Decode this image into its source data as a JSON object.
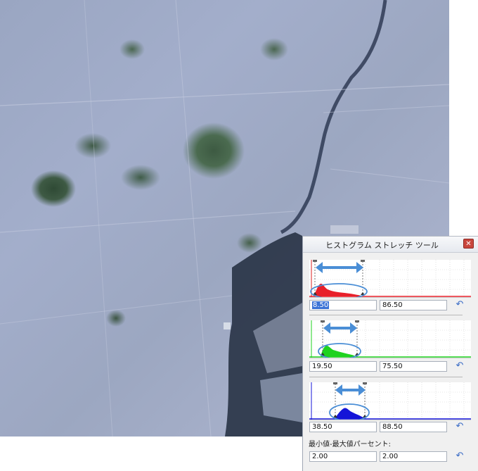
{
  "dialog": {
    "title": "ヒストグラム ストレッチ ツール",
    "close_icon": "close-icon"
  },
  "channels": [
    {
      "name": "red",
      "color": "#e8202a",
      "min_value": "8.50",
      "max_value": "86.50",
      "min_selected": true
    },
    {
      "name": "green",
      "color": "#1fd21f",
      "min_value": "19.50",
      "max_value": "75.50",
      "min_selected": false
    },
    {
      "name": "blue",
      "color": "#1414d8",
      "min_value": "38.50",
      "max_value": "88.50",
      "min_selected": false
    }
  ],
  "percent": {
    "label": "最小値-最大値パーセント:",
    "min_value": "2.00",
    "max_value": "2.00"
  },
  "icons": {
    "reset": "undo-icon",
    "stretch": "double-arrow-icon"
  }
}
